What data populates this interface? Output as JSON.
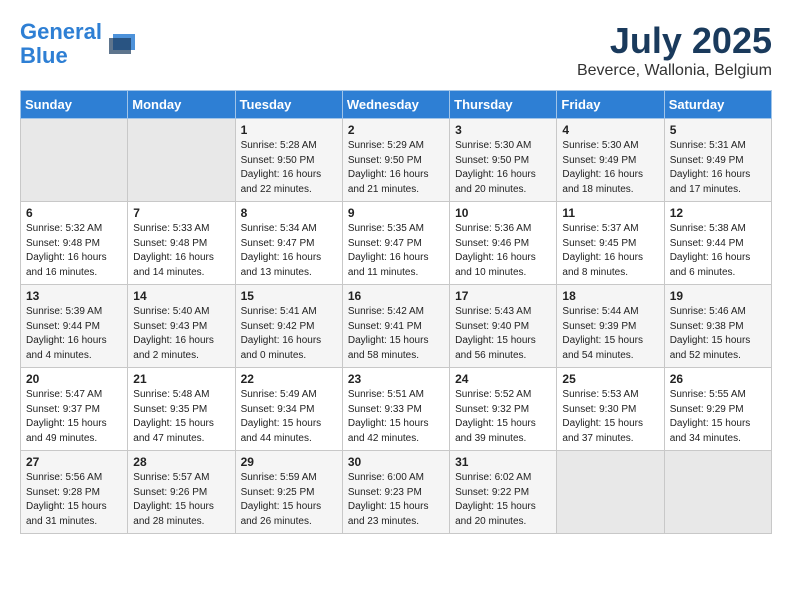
{
  "header": {
    "logo_line1": "General",
    "logo_line2": "Blue",
    "month": "July 2025",
    "location": "Beverce, Wallonia, Belgium"
  },
  "days_of_week": [
    "Sunday",
    "Monday",
    "Tuesday",
    "Wednesday",
    "Thursday",
    "Friday",
    "Saturday"
  ],
  "weeks": [
    [
      {
        "num": "",
        "empty": true
      },
      {
        "num": "",
        "empty": true
      },
      {
        "num": "1",
        "sunrise": "5:28 AM",
        "sunset": "9:50 PM",
        "daylight": "16 hours and 22 minutes."
      },
      {
        "num": "2",
        "sunrise": "5:29 AM",
        "sunset": "9:50 PM",
        "daylight": "16 hours and 21 minutes."
      },
      {
        "num": "3",
        "sunrise": "5:30 AM",
        "sunset": "9:50 PM",
        "daylight": "16 hours and 20 minutes."
      },
      {
        "num": "4",
        "sunrise": "5:30 AM",
        "sunset": "9:49 PM",
        "daylight": "16 hours and 18 minutes."
      },
      {
        "num": "5",
        "sunrise": "5:31 AM",
        "sunset": "9:49 PM",
        "daylight": "16 hours and 17 minutes."
      }
    ],
    [
      {
        "num": "6",
        "sunrise": "5:32 AM",
        "sunset": "9:48 PM",
        "daylight": "16 hours and 16 minutes."
      },
      {
        "num": "7",
        "sunrise": "5:33 AM",
        "sunset": "9:48 PM",
        "daylight": "16 hours and 14 minutes."
      },
      {
        "num": "8",
        "sunrise": "5:34 AM",
        "sunset": "9:47 PM",
        "daylight": "16 hours and 13 minutes."
      },
      {
        "num": "9",
        "sunrise": "5:35 AM",
        "sunset": "9:47 PM",
        "daylight": "16 hours and 11 minutes."
      },
      {
        "num": "10",
        "sunrise": "5:36 AM",
        "sunset": "9:46 PM",
        "daylight": "16 hours and 10 minutes."
      },
      {
        "num": "11",
        "sunrise": "5:37 AM",
        "sunset": "9:45 PM",
        "daylight": "16 hours and 8 minutes."
      },
      {
        "num": "12",
        "sunrise": "5:38 AM",
        "sunset": "9:44 PM",
        "daylight": "16 hours and 6 minutes."
      }
    ],
    [
      {
        "num": "13",
        "sunrise": "5:39 AM",
        "sunset": "9:44 PM",
        "daylight": "16 hours and 4 minutes."
      },
      {
        "num": "14",
        "sunrise": "5:40 AM",
        "sunset": "9:43 PM",
        "daylight": "16 hours and 2 minutes."
      },
      {
        "num": "15",
        "sunrise": "5:41 AM",
        "sunset": "9:42 PM",
        "daylight": "16 hours and 0 minutes."
      },
      {
        "num": "16",
        "sunrise": "5:42 AM",
        "sunset": "9:41 PM",
        "daylight": "15 hours and 58 minutes."
      },
      {
        "num": "17",
        "sunrise": "5:43 AM",
        "sunset": "9:40 PM",
        "daylight": "15 hours and 56 minutes."
      },
      {
        "num": "18",
        "sunrise": "5:44 AM",
        "sunset": "9:39 PM",
        "daylight": "15 hours and 54 minutes."
      },
      {
        "num": "19",
        "sunrise": "5:46 AM",
        "sunset": "9:38 PM",
        "daylight": "15 hours and 52 minutes."
      }
    ],
    [
      {
        "num": "20",
        "sunrise": "5:47 AM",
        "sunset": "9:37 PM",
        "daylight": "15 hours and 49 minutes."
      },
      {
        "num": "21",
        "sunrise": "5:48 AM",
        "sunset": "9:35 PM",
        "daylight": "15 hours and 47 minutes."
      },
      {
        "num": "22",
        "sunrise": "5:49 AM",
        "sunset": "9:34 PM",
        "daylight": "15 hours and 44 minutes."
      },
      {
        "num": "23",
        "sunrise": "5:51 AM",
        "sunset": "9:33 PM",
        "daylight": "15 hours and 42 minutes."
      },
      {
        "num": "24",
        "sunrise": "5:52 AM",
        "sunset": "9:32 PM",
        "daylight": "15 hours and 39 minutes."
      },
      {
        "num": "25",
        "sunrise": "5:53 AM",
        "sunset": "9:30 PM",
        "daylight": "15 hours and 37 minutes."
      },
      {
        "num": "26",
        "sunrise": "5:55 AM",
        "sunset": "9:29 PM",
        "daylight": "15 hours and 34 minutes."
      }
    ],
    [
      {
        "num": "27",
        "sunrise": "5:56 AM",
        "sunset": "9:28 PM",
        "daylight": "15 hours and 31 minutes."
      },
      {
        "num": "28",
        "sunrise": "5:57 AM",
        "sunset": "9:26 PM",
        "daylight": "15 hours and 28 minutes."
      },
      {
        "num": "29",
        "sunrise": "5:59 AM",
        "sunset": "9:25 PM",
        "daylight": "15 hours and 26 minutes."
      },
      {
        "num": "30",
        "sunrise": "6:00 AM",
        "sunset": "9:23 PM",
        "daylight": "15 hours and 23 minutes."
      },
      {
        "num": "31",
        "sunrise": "6:02 AM",
        "sunset": "9:22 PM",
        "daylight": "15 hours and 20 minutes."
      },
      {
        "num": "",
        "empty": true
      },
      {
        "num": "",
        "empty": true
      }
    ]
  ]
}
